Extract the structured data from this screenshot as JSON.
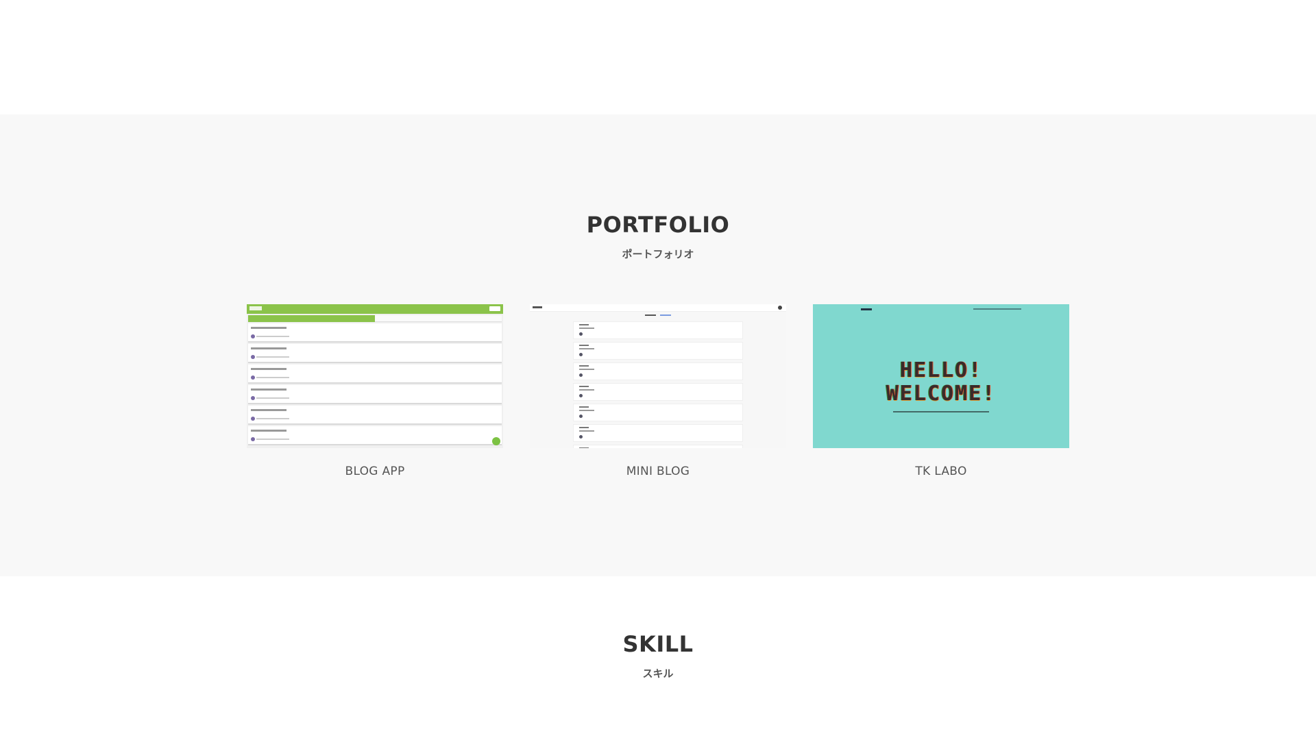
{
  "portfolio": {
    "title": "PORTFOLIO",
    "subtitle": "ポートフォリオ",
    "items": [
      {
        "label": "BLOG APP"
      },
      {
        "label": "MINI BLOG"
      },
      {
        "label": "TK LABO"
      }
    ]
  },
  "tk_labo_thumb": {
    "headline_line1": "HELLO!",
    "headline_line2": "WELCOME!"
  },
  "skill": {
    "title": "SKILL",
    "subtitle": "スキル"
  },
  "colors": {
    "section_bg": "#f8f8f8",
    "blog_app_accent": "#8bc34a",
    "tk_labo_bg": "#80d8cf"
  }
}
